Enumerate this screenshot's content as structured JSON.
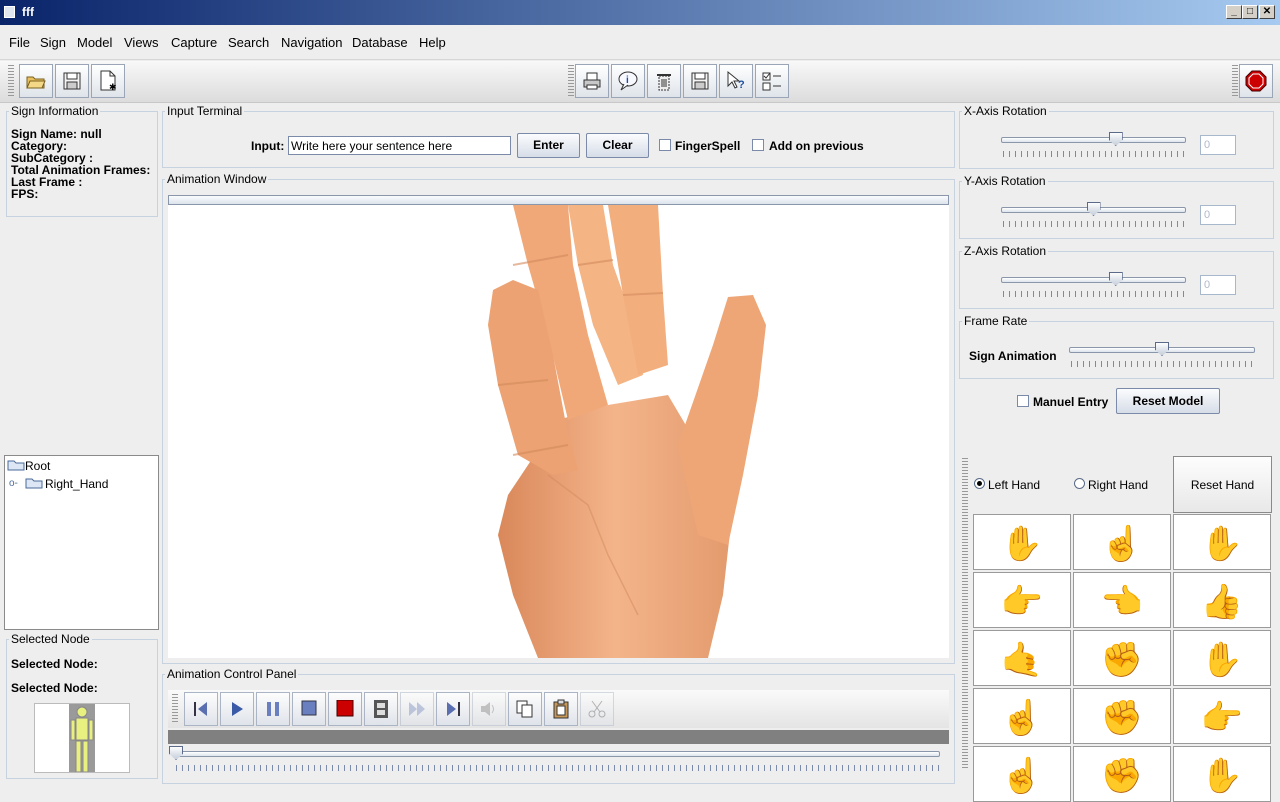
{
  "window": {
    "title": "fff",
    "controls": [
      "_",
      "□",
      "✕"
    ]
  },
  "menu": [
    "File",
    "Sign",
    "Model",
    "Views",
    "Capture",
    "Search",
    "Navigation",
    "Database",
    "Help"
  ],
  "toolbar": {
    "left": [
      "open-folder-icon",
      "save-icon",
      "new-document-icon"
    ],
    "center": [
      "print-icon",
      "info-bubble-icon",
      "delete-icon",
      "save-disk-icon",
      "help-pointer-icon",
      "checklist-icon"
    ],
    "right": [
      "stop-icon"
    ],
    "stop_color": "#cc0000"
  },
  "sign_info": {
    "title": "Sign Information",
    "lines": [
      "Sign Name: null",
      "Category:",
      "SubCategory :",
      "Total Animation Frames:",
      "Last Frame :",
      "FPS:"
    ]
  },
  "tree": {
    "root": "Root",
    "child": "Right_Hand"
  },
  "selected_node": {
    "title": "Selected Node",
    "line1": "Selected Node:",
    "line2": "Selected Node:"
  },
  "input_terminal": {
    "title": "Input Terminal",
    "label": "Input:",
    "value": "Write here your sentence here",
    "enter": "Enter",
    "clear": "Clear",
    "fingerspell": "FingerSpell",
    "add_previous": "Add on previous"
  },
  "animation_window": {
    "title": "Animation Window"
  },
  "control_panel": {
    "title": "Animation Control Panel",
    "buttons": [
      "step-back-icon",
      "play-icon",
      "pause-icon",
      "stop-square-icon",
      "record-icon",
      "film-icon",
      "fast-forward-icon",
      "step-forward-icon",
      "volume-icon",
      "copy-icon",
      "paste-icon",
      "cut-icon"
    ],
    "record_color": "#cc0000",
    "timeline_position": 0
  },
  "rotation": {
    "x": {
      "title": "X-Axis Rotation",
      "value": "0",
      "level": 0.63
    },
    "y": {
      "title": "Y-Axis Rotation",
      "value": "0",
      "level": 0.5
    },
    "z": {
      "title": "Z-Axis Rotation",
      "value": "0",
      "level": 0.63
    }
  },
  "frame_rate": {
    "title": "Frame Rate",
    "label": "Sign Animation",
    "level": 0.5
  },
  "manual": {
    "label": "Manuel Entry",
    "reset_model": "Reset Model"
  },
  "hand_select": {
    "left": "Left Hand",
    "right": "Right Hand",
    "reset": "Reset Hand",
    "selected": "left"
  },
  "handshapes": [
    "handshape-open-hand-icon",
    "handshape-index-up-icon",
    "handshape-flat-hand-icon",
    "handshape-point-right-icon",
    "handshape-point-left-icon",
    "handshape-fist-thumb-icon",
    "handshape-l-shape-icon",
    "handshape-closed-fist-icon",
    "handshape-b-hand-icon",
    "handshape-index-point-icon",
    "handshape-s-fist-icon",
    "handshape-horizontal-point-icon",
    "handshape-partial-1-icon",
    "handshape-partial-2-icon",
    "handshape-partial-3-icon"
  ],
  "colors": {
    "titlebar_start": "#0a246a",
    "titlebar_end": "#a6caf0",
    "skin": "#f0a878"
  }
}
